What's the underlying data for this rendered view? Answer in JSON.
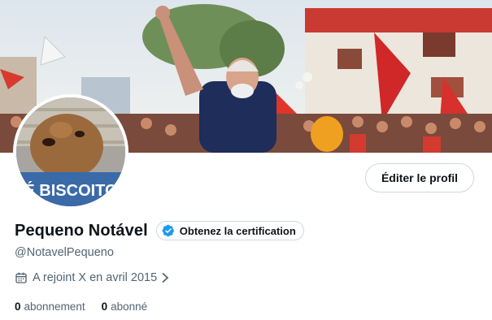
{
  "banner": {
    "image_alt": "crowd-rally-photo"
  },
  "avatar": {
    "image_alt": "dog-photo",
    "caption_text": "É BISCOITO"
  },
  "profile": {
    "display_name": "Pequeno Notável",
    "verify_label": "Obtenez la certification",
    "handle": "@NotavelPequeno",
    "joined_text": "A rejoint X en avril 2015",
    "edit_button_label": "Éditer le profil"
  },
  "stats": {
    "following_count": "0",
    "following_label": "abonnement",
    "followers_count": "0",
    "followers_label": "abonné"
  },
  "colors": {
    "accent": "#1d9bf0",
    "text_primary": "#0f1419",
    "text_secondary": "#536471",
    "border": "#cfd9de"
  },
  "icons": [
    "verified-badge-icon",
    "calendar-icon",
    "chevron-right-icon"
  ]
}
